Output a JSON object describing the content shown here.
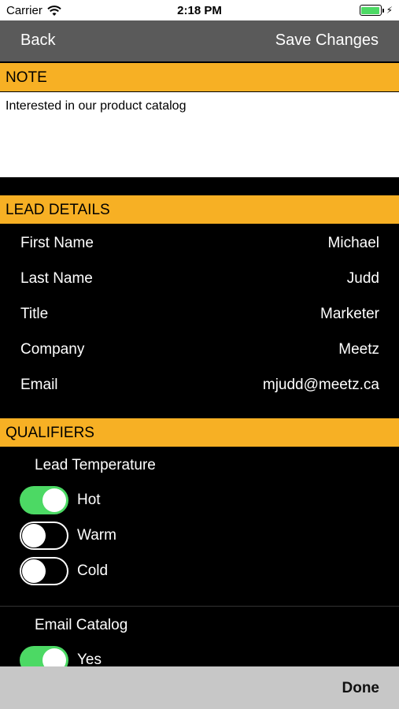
{
  "status_bar": {
    "carrier": "Carrier",
    "time": "2:18 PM"
  },
  "nav": {
    "back_label": "Back",
    "save_label": "Save Changes"
  },
  "note": {
    "header": "NOTE",
    "text": "Interested in our product catalog"
  },
  "lead_details": {
    "header": "LEAD DETAILS",
    "rows": [
      {
        "label": "First Name",
        "value": "Michael"
      },
      {
        "label": "Last Name",
        "value": "Judd"
      },
      {
        "label": "Title",
        "value": "Marketer"
      },
      {
        "label": "Company",
        "value": "Meetz"
      },
      {
        "label": "Email",
        "value": "mjudd@meetz.ca"
      }
    ]
  },
  "qualifiers": {
    "header": "QUALIFIERS",
    "temperature": {
      "label": "Lead Temperature",
      "options": [
        {
          "label": "Hot",
          "on": true
        },
        {
          "label": "Warm",
          "on": false
        },
        {
          "label": "Cold",
          "on": false
        }
      ]
    },
    "email_catalog": {
      "label": "Email Catalog",
      "options": [
        {
          "label": "Yes",
          "on": true
        }
      ]
    }
  },
  "toolbar": {
    "done_label": "Done"
  },
  "colors": {
    "accent": "#f7b024",
    "toggle_on": "#4cd964",
    "nav_bg": "#5a5a5a",
    "toolbar_bg": "#c7c7c7"
  }
}
